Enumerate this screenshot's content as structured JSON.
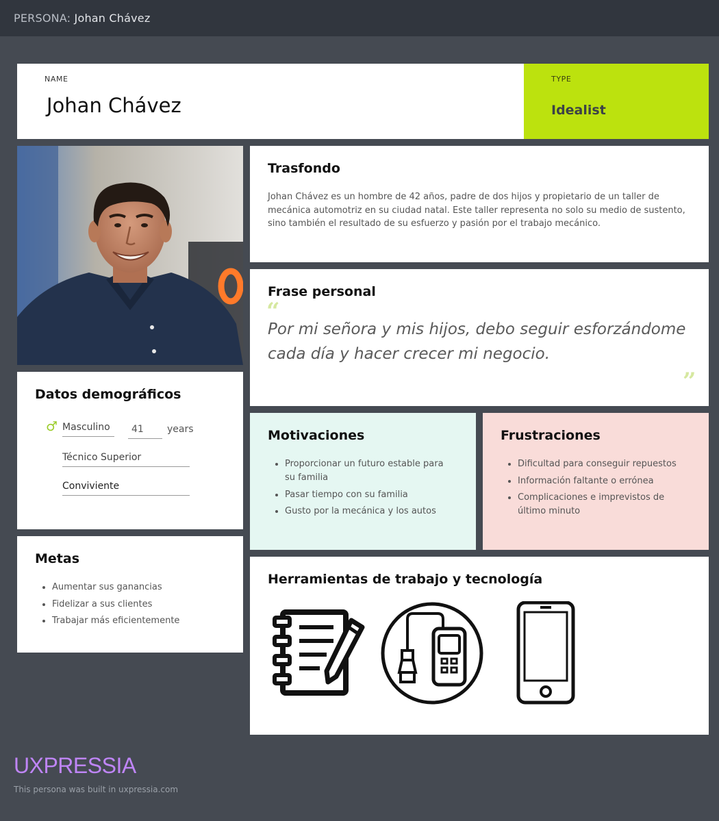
{
  "topbar": {
    "prefix": "PERSONA:",
    "name": "Johan Chávez"
  },
  "header": {
    "name_label": "NAME",
    "name": "Johan Chávez",
    "type_label": "TYPE",
    "type": "Idealist",
    "type_color": "#bce20e"
  },
  "photo": {
    "subject": "portrait-of-smiling-man"
  },
  "background": {
    "title": "Trasfondo",
    "text": "Johan Chávez es un hombre de 42 años, padre de dos hijos y propietario de un taller de mecánica automotriz en su ciudad natal. Este taller representa no solo su medio de sustento, sino también el resultado de su esfuerzo y pasión por el trabajo mecánico."
  },
  "quote": {
    "title": "Frase personal",
    "open_mark": "“",
    "close_mark": "”",
    "text": "Por mi señora y mis hijos, debo seguir esforzándome cada día y hacer crecer mi negocio."
  },
  "demographics": {
    "title": "Datos demográficos",
    "gender_icon": "male-icon",
    "gender": "Masculino",
    "age": "41",
    "age_unit": "years",
    "education": "Técnico Superior",
    "civil_status": "Conviviente"
  },
  "motivations": {
    "title": "Motivaciones",
    "bg_color": "#e5f7f2",
    "items": [
      "Proporcionar un futuro estable para su familia",
      "Pasar tiempo con su familia",
      "Gusto por la mecánica y los autos"
    ]
  },
  "frustrations": {
    "title": "Frustraciones",
    "bg_color": "#f9dcd9",
    "items": [
      "Dificultad para conseguir repuestos",
      "Información faltante o errónea",
      "Complicaciones e imprevistos de último minuto"
    ]
  },
  "goals": {
    "title": "Metas",
    "items": [
      "Aumentar sus ganancias",
      "Fidelizar a sus clientes",
      "Trabajar más eficientemente"
    ]
  },
  "tools": {
    "title": "Herramientas de trabajo y tecnología",
    "icons": [
      "notebook-pen-icon",
      "obd-scanner-icon",
      "smartphone-icon"
    ]
  },
  "footer": {
    "brand": "UXPRESSIA",
    "brand_color": "#bf85f7",
    "built_text": "This persona was built in uxpressia.com"
  }
}
